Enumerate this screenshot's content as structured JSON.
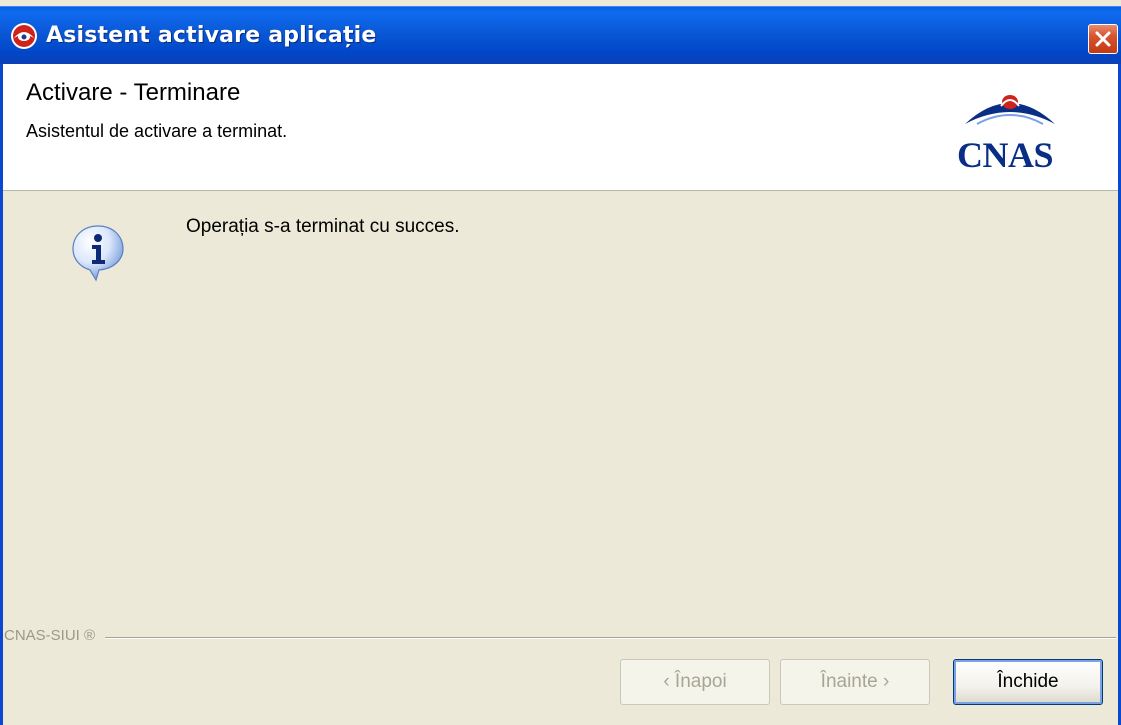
{
  "window": {
    "title": "Asistent activare aplicație",
    "close_label": "Close"
  },
  "header": {
    "title": "Activare - Terminare",
    "subtitle": "Asistentul de activare a terminat.",
    "logo_text": "CNAS"
  },
  "content": {
    "message": "Operația s-a terminat cu succes.",
    "icon": "info-icon"
  },
  "footer": {
    "brand": "CNAS-SIUI ®",
    "back_label": "‹ Înapoi",
    "next_label": "Înainte ›",
    "close_label": "Închide"
  },
  "colors": {
    "titlebar": "#0a58d6",
    "dialog_bg": "#ece9d8",
    "header_bg": "#ffffff",
    "logo": "#0a2e86"
  }
}
